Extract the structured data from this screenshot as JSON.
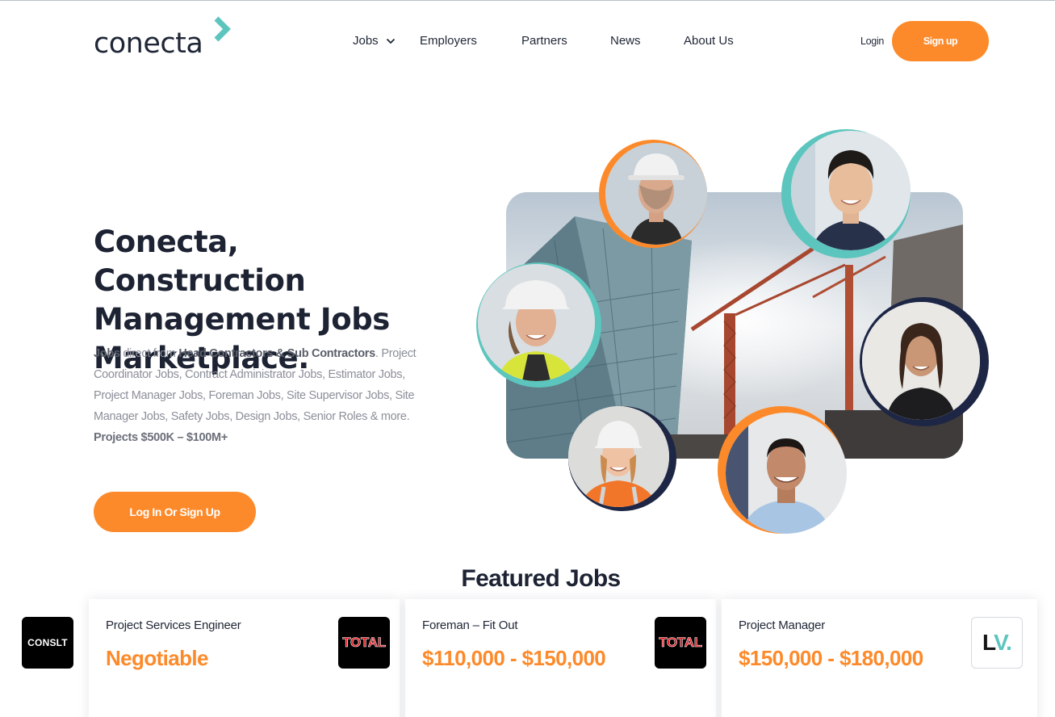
{
  "brand": {
    "name": "conecta",
    "accent": "#fd8a2a",
    "teal": "#5cc5be",
    "navy": "#1d2333"
  },
  "nav": {
    "items": [
      {
        "label": "Jobs",
        "has_dropdown": true
      },
      {
        "label": "Employers"
      },
      {
        "label": "Partners"
      },
      {
        "label": "News"
      },
      {
        "label": "About Us"
      }
    ],
    "login": "Login",
    "signup": "Sign up"
  },
  "hero": {
    "title": "Conecta, Construction Management Jobs Marketplace.",
    "desc_jobs": "Jobs",
    "desc_direct": " direct from ",
    "desc_contractors": "Head Contractors & Sub Contractors",
    "desc_rest": ". Project Coordinator Jobs, Contract Administrator Jobs, Estimator Jobs, Project Manager Jobs, Foreman Jobs, Site Supervisor Jobs, Site Manager Jobs, Safety Jobs, Design Jobs, Senior Roles & more.",
    "projects": "Projects $500K – $100M+",
    "cta": "Log In Or Sign Up"
  },
  "featured": {
    "title": "Featured Jobs",
    "jobs": [
      {
        "title": "Project Services Engineer",
        "salary": "Negotiable",
        "logo_text": "CONSLT",
        "logo_style": "dark"
      },
      {
        "title": "Foreman – Fit Out",
        "salary": "$110,000 - $150,000",
        "logo_text": "TOTAL",
        "logo_style": "dark"
      },
      {
        "title": "Project Manager",
        "salary": "$150,000 - $180,000",
        "logo_text": "LV.",
        "logo_style": "light"
      }
    ],
    "partial_logo_text": "TOTAL"
  }
}
